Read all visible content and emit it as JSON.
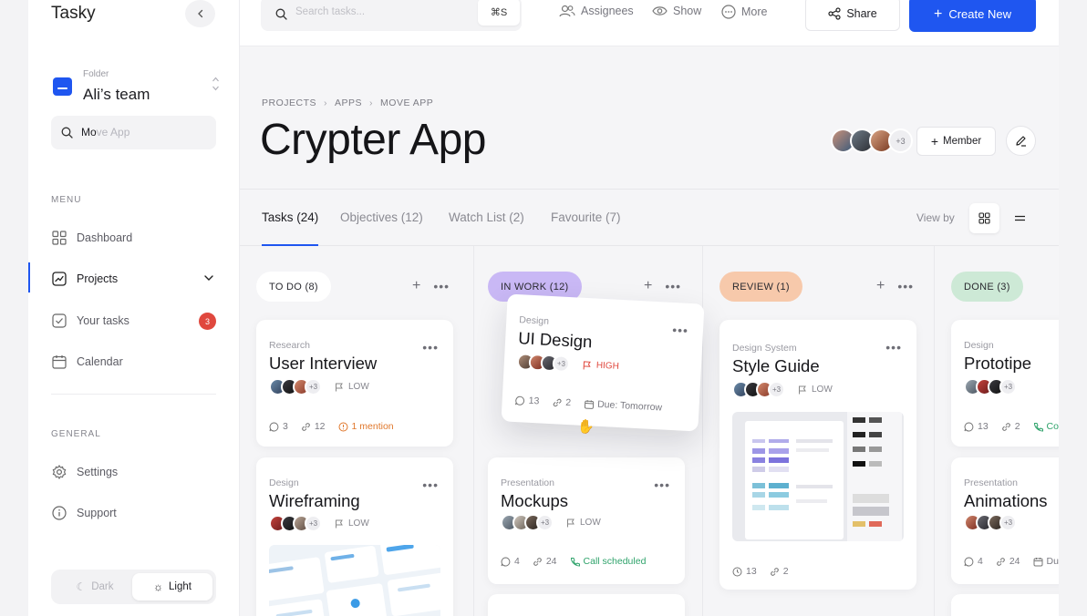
{
  "app": {
    "name": "Tasky"
  },
  "sidebar": {
    "folder_caption": "Folder",
    "folder_name": "Ali’s team",
    "search_typed": "Mo",
    "search_ghost": "ve App",
    "menu_label": "MENU",
    "menu": [
      {
        "label": "Dashboard",
        "icon": "grid-icon"
      },
      {
        "label": "Projects",
        "icon": "chart-icon",
        "active": true
      },
      {
        "label": "Your tasks",
        "icon": "check-icon",
        "badge": "3"
      },
      {
        "label": "Calendar",
        "icon": "calendar-icon"
      }
    ],
    "general_label": "GENERAL",
    "general": [
      {
        "label": "Settings",
        "icon": "gear-icon"
      },
      {
        "label": "Support",
        "icon": "info-icon"
      }
    ],
    "theme": {
      "dark": "Dark",
      "light": "Light",
      "selected": "Light"
    }
  },
  "topbar": {
    "search_placeholder": "Search tasks...",
    "shortcut": "⌘S",
    "assignees": "Assignees",
    "show": "Show",
    "more": "More",
    "share": "Share",
    "create": "Create New"
  },
  "header": {
    "breadcrumb": [
      "PROJECTS",
      "APPS",
      "MOVE APP"
    ],
    "title": "Crypter App",
    "member_extra": "+3",
    "member_button": "Member"
  },
  "tabs": [
    {
      "label": "Tasks (24)",
      "active": true
    },
    {
      "label": "Objectives (12)"
    },
    {
      "label": "Watch List (2)"
    },
    {
      "label": "Favourite (7)"
    }
  ],
  "view_by": "View by",
  "columns": [
    {
      "label": "TO DO (8)",
      "color": "#ffffff"
    },
    {
      "label": "IN WORK (12)",
      "color": "#c9b8f5"
    },
    {
      "label": "REVIEW (1)",
      "color": "#f7c9ab"
    },
    {
      "label": "DONE (3)",
      "color": "#cde9d6"
    }
  ],
  "cards": {
    "user_interview": {
      "category": "Research",
      "title": "User Interview",
      "extra": "+3",
      "priority": "LOW",
      "comments": "3",
      "links": "12",
      "note": "1 mention"
    },
    "wireframing": {
      "category": "Design",
      "title": "Wireframing",
      "extra": "+3",
      "priority": "LOW"
    },
    "ui_design": {
      "category": "Design",
      "title": "UI Design",
      "extra": "+3",
      "priority": "HIGH",
      "comments": "13",
      "links": "2",
      "due": "Due: Tomorrow"
    },
    "mockups": {
      "category": "Presentation",
      "title": "Mockups",
      "extra": "+3",
      "priority": "LOW",
      "comments": "4",
      "links": "24",
      "note": "Call scheduled"
    },
    "style_guide": {
      "category": "Design System",
      "title": "Style Guide",
      "extra": "+3",
      "priority": "LOW",
      "comments": "13",
      "links": "2"
    },
    "prototipe": {
      "category": "Design",
      "title": "Prototipe",
      "extra": "+3",
      "comments": "13",
      "links": "2",
      "note": "Co"
    },
    "animations": {
      "category": "Presentation",
      "title": "Animations",
      "extra": "+3",
      "comments": "4",
      "links": "24",
      "note": "Du"
    }
  },
  "colors": {
    "accent": "#1f56f0",
    "badge": "#e0483e",
    "high": "#e0483e",
    "call": "#2fa36b",
    "mention": "#e0772b"
  }
}
